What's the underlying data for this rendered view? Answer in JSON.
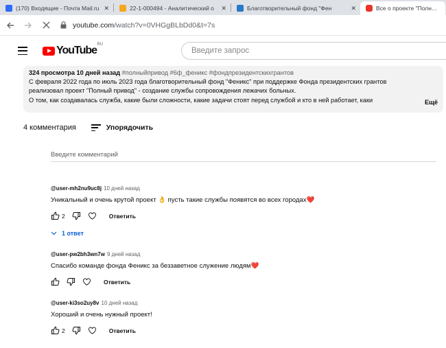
{
  "browser": {
    "tabs": [
      {
        "title": "(170) Входящие - Почта Mail.ru",
        "color": "#2f6bf5"
      },
      {
        "title": "22-1-000494 - Аналитический о",
        "color": "#f5a623"
      },
      {
        "title": "Благотворительный фонд \"Фен",
        "color": "#2a78c8"
      },
      {
        "title": "Все о проекте \"Полный п",
        "color": "#e8352a"
      }
    ],
    "url_host": "youtube.com",
    "url_path": "/watch?v=0VHGgBLbDd0&t=7s"
  },
  "youtube": {
    "logo_text": "YouTube",
    "region": "RU",
    "search_placeholder": "Введите запрос"
  },
  "description": {
    "meta": "324 просмотра  10 дней назад",
    "tags": "#полныйпривод #6ф_феникс #фондпрезидентскихгрантов",
    "line1": "С февраля 2022 года по июль 2023 года благотворительный фонд \"Феникс\" при поддержке Фонда президентских грантов",
    "line2": "реализовал проект \"Полный привод\" - создание службы сопровождения лежачих больных.",
    "line3": "О том, как создавалась служба, какие были сложности, какие задачи стоят перед службой и кто в ней работает, каки",
    "more": "Ещё"
  },
  "comments_section": {
    "count_label": "4 комментария",
    "sort_label": "Упорядочить",
    "add_placeholder": "Введите комментарий",
    "reply_label": "Ответить",
    "items": [
      {
        "author": "@user-mh2nu9uc8j",
        "time": "10 дней назад",
        "text": "Уникальный и очень крутой проект 👌 пусть такие службы появятся во всех городах❤️",
        "likes": "2",
        "replies": "1 ответ"
      },
      {
        "author": "@user-pw2bh3wn7w",
        "time": "9 дней назад",
        "text": "Спасибо команде фонда Феникс за беззаветное служение людям❤️",
        "likes": ""
      },
      {
        "author": "@user-ki3so2uy8v",
        "time": "10 дней назад",
        "text": "Хороший и очень нужный проект!",
        "likes": "2"
      }
    ]
  }
}
